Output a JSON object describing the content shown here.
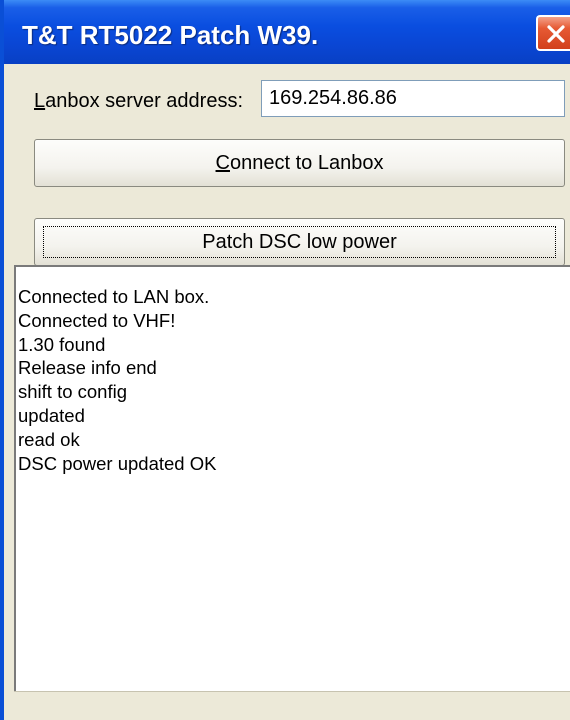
{
  "window": {
    "title": "T&T RT5022 Patch W39."
  },
  "form": {
    "address_label_mnemonic": "L",
    "address_label_rest": "anbox server address:",
    "address_value": "169.254.86.86"
  },
  "buttons": {
    "connect_mnemonic": "C",
    "connect_rest": "onnect to Lanbox",
    "patch_label": "Patch DSC low power"
  },
  "log": {
    "lines": [
      "Connected to LAN box.",
      "Connected to VHF!",
      "1.30 found",
      "Release info end",
      "shift to config",
      "updated",
      "read ok",
      "DSC power updated OK"
    ]
  },
  "status": {
    "text": ""
  },
  "colors": {
    "title_bar": "#0a4ee0",
    "close_button": "#e65a34",
    "dialog_background": "#ece9d8"
  },
  "icons": {
    "close": "close-icon"
  }
}
